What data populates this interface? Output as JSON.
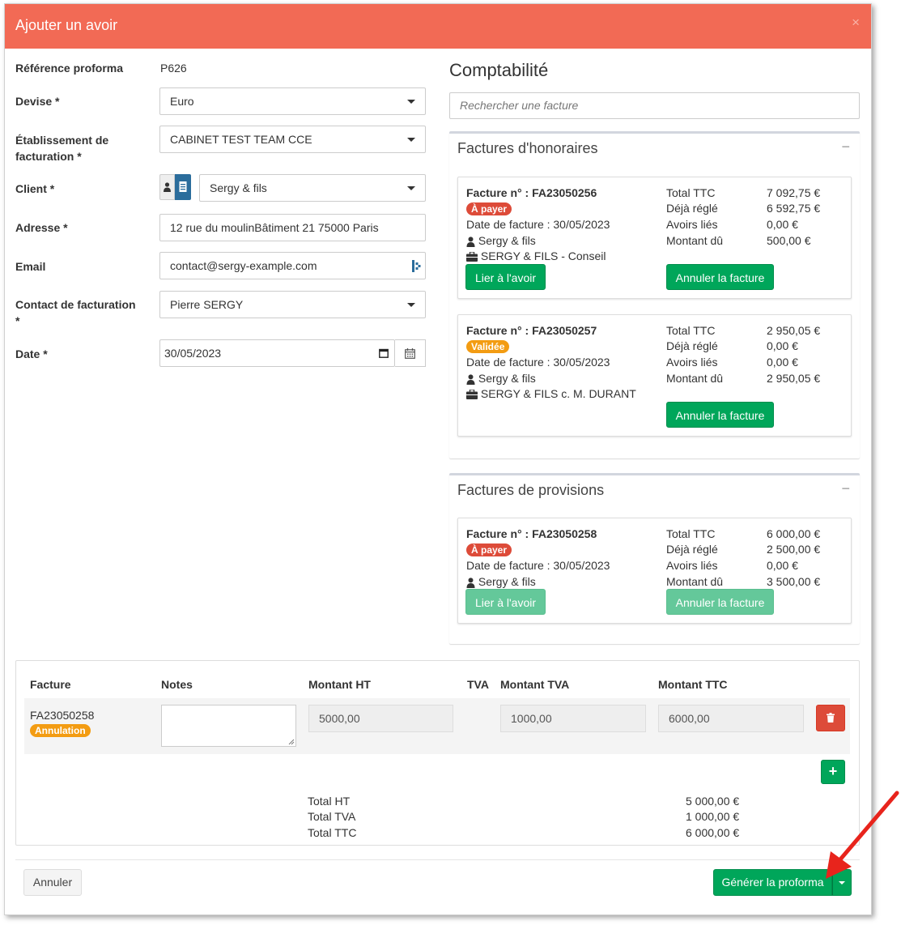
{
  "modal": {
    "title": "Ajouter un avoir",
    "close": "×"
  },
  "form": {
    "ref_label": "Référence proforma",
    "ref_value": "P626",
    "devise_label": "Devise *",
    "devise_value": "Euro",
    "etab_label": "Établissement de facturation *",
    "etab_value": "CABINET TEST TEAM CCE",
    "client_label": "Client *",
    "client_value": "Sergy & fils",
    "adresse_label": "Adresse *",
    "adresse_value": "12 rue du moulinBâtiment 21 75000 Paris",
    "email_label": "Email",
    "email_value": "contact@sergy-example.com",
    "contact_label": "Contact de facturation *",
    "contact_value": "Pierre SERGY",
    "date_label": "Date *",
    "date_value": "30/05/2023"
  },
  "compta": {
    "title": "Comptabilité",
    "search_placeholder": "Rechercher une facture",
    "honoraires_title": "Factures d'honoraires",
    "provisions_title": "Factures de provisions",
    "minus": "−",
    "labels": {
      "total_ttc": "Total TTC",
      "deja_regle": "Déjà réglé",
      "avoirs_lies": "Avoirs liés",
      "montant_du": "Montant dû",
      "facture_no": "Facture n° : "
    },
    "invoices": [
      {
        "number": "FA23050256",
        "status": "À payer",
        "date": "Date de facture : 30/05/2023",
        "client": "Sergy & fils",
        "dossier": "SERGY & FILS - Conseil",
        "total_ttc": "7 092,75 €",
        "deja_regle": "6 592,75 €",
        "avoirs_lies": "0,00 €",
        "montant_du": "500,00 €",
        "btn_lier": "Lier à l'avoir",
        "btn_annuler": "Annuler la facture"
      },
      {
        "number": "FA23050257",
        "status": "Validée",
        "date": "Date de facture : 30/05/2023",
        "client": "Sergy & fils",
        "dossier": "SERGY & FILS c. M. DURANT",
        "total_ttc": "2 950,05 €",
        "deja_regle": "0,00 €",
        "avoirs_lies": "0,00 €",
        "montant_du": "2 950,05 €",
        "btn_annuler": "Annuler la facture"
      },
      {
        "number": "FA23050258",
        "status": "À payer",
        "date": "Date de facture : 30/05/2023",
        "client": "Sergy & fils",
        "total_ttc": "6 000,00 €",
        "deja_regle": "2 500,00 €",
        "avoirs_lies": "0,00 €",
        "montant_du": "3 500,00 €",
        "btn_lier": "Lier à l'avoir",
        "btn_annuler": "Annuler la facture"
      }
    ]
  },
  "lines": {
    "headers": {
      "facture": "Facture",
      "notes": "Notes",
      "montant_ht": "Montant HT",
      "tva": "TVA",
      "montant_tva": "Montant TVA",
      "montant_ttc": "Montant TTC"
    },
    "row": {
      "facture": "FA23050258",
      "badge": "Annulation",
      "montant_ht": "5000,00",
      "montant_tva": "1000,00",
      "montant_ttc": "6000,00"
    },
    "totals": [
      {
        "label": "Total HT",
        "value": "5 000,00 €"
      },
      {
        "label": "Total TVA",
        "value": "1 000,00 €"
      },
      {
        "label": "Total TTC",
        "value": "6 000,00 €"
      }
    ],
    "add": "+"
  },
  "footer": {
    "cancel": "Annuler",
    "generate": "Générer la proforma"
  },
  "colors": {
    "header": "#f26a55",
    "green": "#00a65a",
    "red": "#dd4b39",
    "orange": "#f39c12",
    "annotation_arrow": "#e8241c"
  }
}
